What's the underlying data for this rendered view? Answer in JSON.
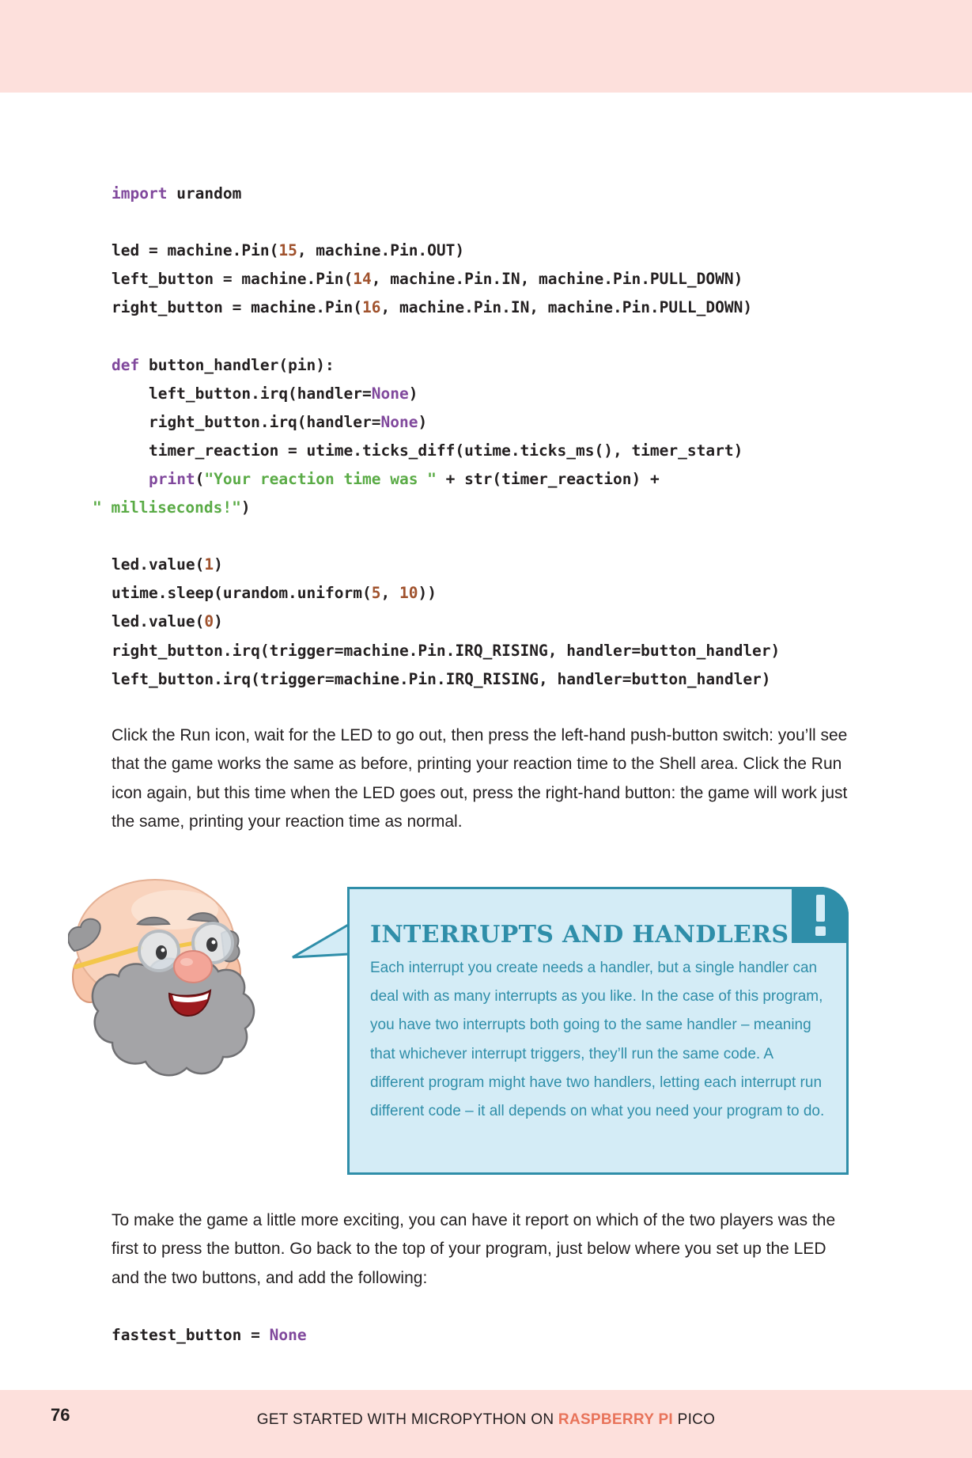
{
  "code_block_1": [
    [
      {
        "t": "import",
        "c": "kw"
      },
      {
        "t": " urandom"
      }
    ],
    [],
    [
      {
        "t": "led = machine.Pin("
      },
      {
        "t": "15",
        "c": "num"
      },
      {
        "t": ", machine.Pin.OUT)"
      }
    ],
    [
      {
        "t": "left_button = machine.Pin("
      },
      {
        "t": "14",
        "c": "num"
      },
      {
        "t": ", machine.Pin.IN, machine.Pin.PULL_DOWN)"
      }
    ],
    [
      {
        "t": "right_button = machine.Pin("
      },
      {
        "t": "16",
        "c": "num"
      },
      {
        "t": ", machine.Pin.IN, machine.Pin.PULL_DOWN)"
      }
    ],
    [],
    [
      {
        "t": "def",
        "c": "kw"
      },
      {
        "t": " button_handler(pin):"
      }
    ],
    [
      {
        "t": "    left_button.irq(handler="
      },
      {
        "t": "None",
        "c": "kw"
      },
      {
        "t": ")"
      }
    ],
    [
      {
        "t": "    right_button.irq(handler="
      },
      {
        "t": "None",
        "c": "kw"
      },
      {
        "t": ")"
      }
    ],
    [
      {
        "t": "    timer_reaction = utime.ticks_diff(utime.ticks_ms(), timer_start)"
      }
    ],
    [
      {
        "t": "    "
      },
      {
        "t": "print",
        "c": "kw"
      },
      {
        "t": "("
      },
      {
        "t": "\"Your reaction time was \"",
        "c": "str"
      },
      {
        "t": " + str(timer_reaction) +"
      }
    ],
    [
      {
        "t": "\" milliseconds!\"",
        "c": "str"
      },
      {
        "t": ")"
      }
    ],
    [],
    [
      {
        "t": "led.value("
      },
      {
        "t": "1",
        "c": "num"
      },
      {
        "t": ")"
      }
    ],
    [
      {
        "t": "utime.sleep(urandom.uniform("
      },
      {
        "t": "5",
        "c": "num"
      },
      {
        "t": ", "
      },
      {
        "t": "10",
        "c": "num"
      },
      {
        "t": "))"
      }
    ],
    [
      {
        "t": "led.value("
      },
      {
        "t": "0",
        "c": "num"
      },
      {
        "t": ")"
      }
    ],
    [
      {
        "t": "right_button.irq(trigger=machine.Pin.IRQ_RISING, handler=button_handler)"
      }
    ],
    [
      {
        "t": "left_button.irq(trigger=machine.Pin.IRQ_RISING, handler=button_handler)"
      }
    ]
  ],
  "paragraph_1": "Click the Run icon, wait for the LED to go out, then press the left-hand push-button switch: you’ll see that the game works the same as before, printing your reaction time to the Shell area. Click the Run icon again, but this time when the LED goes out, press the right-hand button: the game will work just the same, printing your reaction time as normal.",
  "callout": {
    "title": "INTERRUPTS AND HANDLERS",
    "body": "Each interrupt you create needs a handler, but a single handler can deal with as many interrupts as you like. In the case of this program, you have two interrupts both going to the same handler – meaning that whichever interrupt triggers, they’ll run the same code. A different program might have two handlers, letting each interrupt run different code – it all depends on what you need your program to do.",
    "icon": "exclamation-icon"
  },
  "paragraph_2": "To make the game a little more exciting, you can have it report on which of the two players was the first to press the button. Go back to the top of your program, just below where you set up the LED and the two buttons, and add the following:",
  "code_block_2": [
    [
      {
        "t": "fastest_button = "
      },
      {
        "t": "None",
        "c": "kw"
      }
    ]
  ],
  "footer": {
    "page_number": "76",
    "title_pre": "GET STARTED WITH MICROPYTHON ON ",
    "title_accent": "RASPBERRY PI",
    "title_post": " PICO"
  },
  "colors": {
    "band": "#fde0dc",
    "keyword": "#80489c",
    "number": "#a0522d",
    "string": "#5aab46",
    "callout_accent": "#2f8ea9",
    "callout_bg": "#d4ecf6",
    "footer_accent": "#e8735a"
  }
}
